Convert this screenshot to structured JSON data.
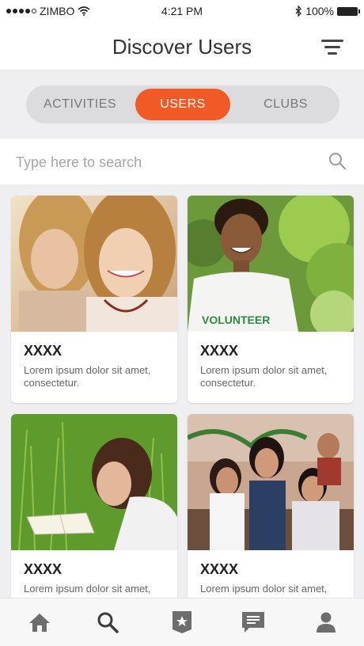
{
  "status": {
    "carrier": "ZIMBO",
    "time": "4:21 PM",
    "battery": "100%"
  },
  "header": {
    "title": "Discover Users"
  },
  "tabs": [
    {
      "label": "ACTIVITIES",
      "active": false
    },
    {
      "label": "USERS",
      "active": true
    },
    {
      "label": "CLUBS",
      "active": false
    }
  ],
  "search": {
    "placeholder": "Type here to search"
  },
  "cards": [
    {
      "title": "XXXX",
      "desc": "Lorem ipsum dolor sit amet, consectetur."
    },
    {
      "title": "XXXX",
      "desc": "Lorem ipsum dolor sit amet, consectetur."
    },
    {
      "title": "XXXX",
      "desc": "Lorem ipsum dolor sit amet, consectetur."
    },
    {
      "title": "XXXX",
      "desc": "Lorem ipsum dolor sit amet, consectetur."
    }
  ],
  "bottom_nav": [
    "home-icon",
    "search-icon",
    "badge-icon",
    "chat-icon",
    "profile-icon"
  ],
  "colors": {
    "accent": "#f15a24",
    "background": "#efeff2",
    "nav_icon": "#6d6d6d",
    "nav_active": "#3c3c3c"
  }
}
